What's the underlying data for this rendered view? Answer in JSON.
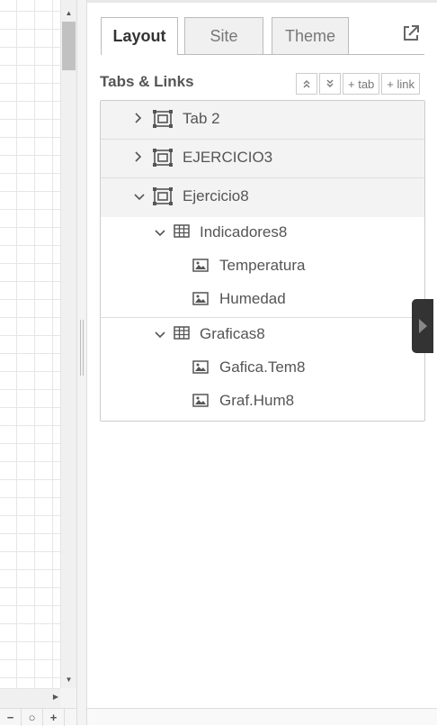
{
  "canvas": {
    "zoom_out_label": "−",
    "zoom_reset_label": "○",
    "zoom_in_label": "+"
  },
  "sidebar": {
    "tabs": [
      {
        "label": "Layout",
        "active": true
      },
      {
        "label": "Site",
        "active": false
      },
      {
        "label": "Theme",
        "active": false
      }
    ],
    "section_title": "Tabs & Links",
    "actions": {
      "expand_all": "expand-all",
      "collapse_all": "collapse-all",
      "add_tab": "+ tab",
      "add_link": "+ link"
    },
    "tree": {
      "tab2": "Tab 2",
      "ejercicio3": "EJERCICIO3",
      "ejercicio8": "Ejercicio8",
      "group1": "Indicadores8",
      "g1_item1": "Temperatura",
      "g1_item2": "Humedad",
      "group2": "Graficas8",
      "g2_item1": "Gafica.Tem8",
      "g2_item2": "Graf.Hum8"
    }
  },
  "colors": {
    "accent_dark": "#333333",
    "border": "#cccccc",
    "row_bg": "#f3f3f3"
  }
}
